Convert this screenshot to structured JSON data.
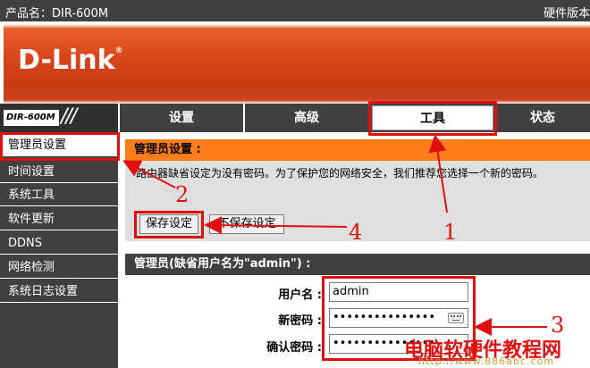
{
  "topbar": {
    "product": "产品名：DIR-600M",
    "hardware": "硬件版本"
  },
  "banner": {
    "logo": "D-Link",
    "trademark": "®"
  },
  "model_badge": {
    "model": "DIR-600M",
    "slashes": "///"
  },
  "nav": {
    "tabs": [
      {
        "label": "设置",
        "active": false
      },
      {
        "label": "高级",
        "active": false
      },
      {
        "label": "工具",
        "active": true
      },
      {
        "label": "状态",
        "active": false
      }
    ]
  },
  "sidebar": {
    "items": [
      {
        "label": "管理员设置",
        "active": true
      },
      {
        "label": "时间设置",
        "active": false
      },
      {
        "label": "系统工具",
        "active": false
      },
      {
        "label": "软件更新",
        "active": false
      },
      {
        "label": "DDNS",
        "active": false
      },
      {
        "label": "网络检测",
        "active": false
      },
      {
        "label": "系统日志设置",
        "active": false
      }
    ]
  },
  "admin_section": {
    "title": "管理员设置 :",
    "description": "路由器缺省设定为没有密码。为了保护您的网络安全，我们推荐您选择一个新的密码。",
    "save_label": "保存设定",
    "nosave_label": "不保存设定"
  },
  "account_section": {
    "title": "管理员(缺省用户名为\"admin\") :",
    "username_label": "用户名 :",
    "username_value": "admin",
    "password_label": "新密码 :",
    "password_value": "•••••••••••••••",
    "confirm_label": "确认密码 :",
    "confirm_value": "•••••••••••••••"
  },
  "annotations": {
    "n1": "1",
    "n2": "2",
    "n3": "3",
    "n4": "4"
  },
  "watermark": {
    "text": "电脑软硬件教程网",
    "url": "http://www.886abc.com"
  },
  "colors": {
    "accent": "#ff7d1a",
    "nav_bg": "#404040",
    "annotation": "#e01010"
  }
}
